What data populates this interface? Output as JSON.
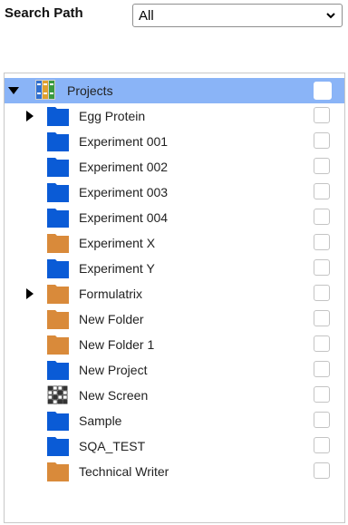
{
  "search": {
    "label": "Search Path",
    "selected": "All"
  },
  "tree": {
    "root": {
      "label": "Projects",
      "icon": "bookshelf-icon"
    },
    "items": [
      {
        "label": "Egg Protein",
        "icon": "folder-blue",
        "expandable": true
      },
      {
        "label": "Experiment 001",
        "icon": "folder-blue",
        "expandable": false
      },
      {
        "label": "Experiment 002",
        "icon": "folder-blue",
        "expandable": false
      },
      {
        "label": "Experiment 003",
        "icon": "folder-blue",
        "expandable": false
      },
      {
        "label": "Experiment 004",
        "icon": "folder-blue",
        "expandable": false
      },
      {
        "label": "Experiment X",
        "icon": "folder-orange",
        "expandable": false
      },
      {
        "label": "Experiment Y",
        "icon": "folder-blue",
        "expandable": false
      },
      {
        "label": "Formulatrix",
        "icon": "folder-orange",
        "expandable": true
      },
      {
        "label": "New Folder",
        "icon": "folder-orange",
        "expandable": false
      },
      {
        "label": "New Folder 1",
        "icon": "folder-orange",
        "expandable": false
      },
      {
        "label": "New Project",
        "icon": "folder-blue",
        "expandable": false
      },
      {
        "label": "New Screen",
        "icon": "screen-grid",
        "expandable": false
      },
      {
        "label": "Sample",
        "icon": "folder-blue",
        "expandable": false
      },
      {
        "label": "SQA_TEST",
        "icon": "folder-blue",
        "expandable": false
      },
      {
        "label": "Technical Writer",
        "icon": "folder-orange",
        "expandable": false
      }
    ]
  },
  "colors": {
    "folder_blue": "#0a5bd6",
    "folder_orange": "#d98a3a",
    "selection": "#8ab4f7"
  }
}
